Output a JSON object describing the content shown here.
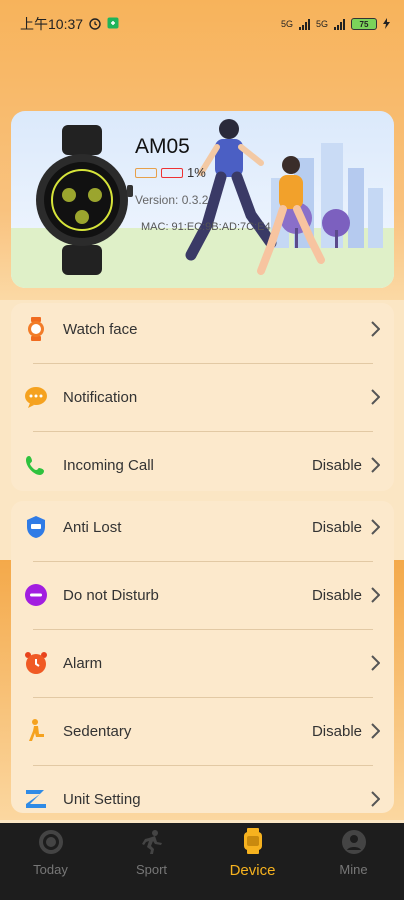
{
  "status_bar": {
    "time": "上午10:37",
    "network": "5G",
    "battery": "75"
  },
  "device": {
    "name": "AM05",
    "battery_percent": "1%",
    "version": "Version: 0.3.2",
    "mac": "MAC: 91:EC:9B:AD:7C:E4"
  },
  "settings_group_1": [
    {
      "label": "Watch face",
      "value": "",
      "icon": "watch-icon"
    },
    {
      "label": "Notification",
      "value": "",
      "icon": "chat-bubble-icon"
    },
    {
      "label": "Incoming Call",
      "value": "Disable",
      "icon": "phone-icon"
    }
  ],
  "settings_group_2": [
    {
      "label": "Anti Lost",
      "value": "Disable",
      "icon": "shield-icon"
    },
    {
      "label": "Do not Disturb",
      "value": "Disable",
      "icon": "minus-circle-icon"
    },
    {
      "label": "Alarm",
      "value": "",
      "icon": "alarm-clock-icon"
    },
    {
      "label": "Sedentary",
      "value": "Disable",
      "icon": "sitting-person-icon"
    },
    {
      "label": "Unit Setting",
      "value": "",
      "icon": "unit-icon"
    }
  ],
  "tabs": [
    {
      "label": "Today",
      "icon": "target-icon",
      "active": false
    },
    {
      "label": "Sport",
      "icon": "runner-icon",
      "active": false
    },
    {
      "label": "Device",
      "icon": "watch-icon",
      "active": true
    },
    {
      "label": "Mine",
      "icon": "profile-icon",
      "active": false
    }
  ],
  "colors": {
    "accent": "#f6b21f",
    "card_bg": "#fce9cc",
    "tabbar_bg": "#1d1d1d"
  }
}
